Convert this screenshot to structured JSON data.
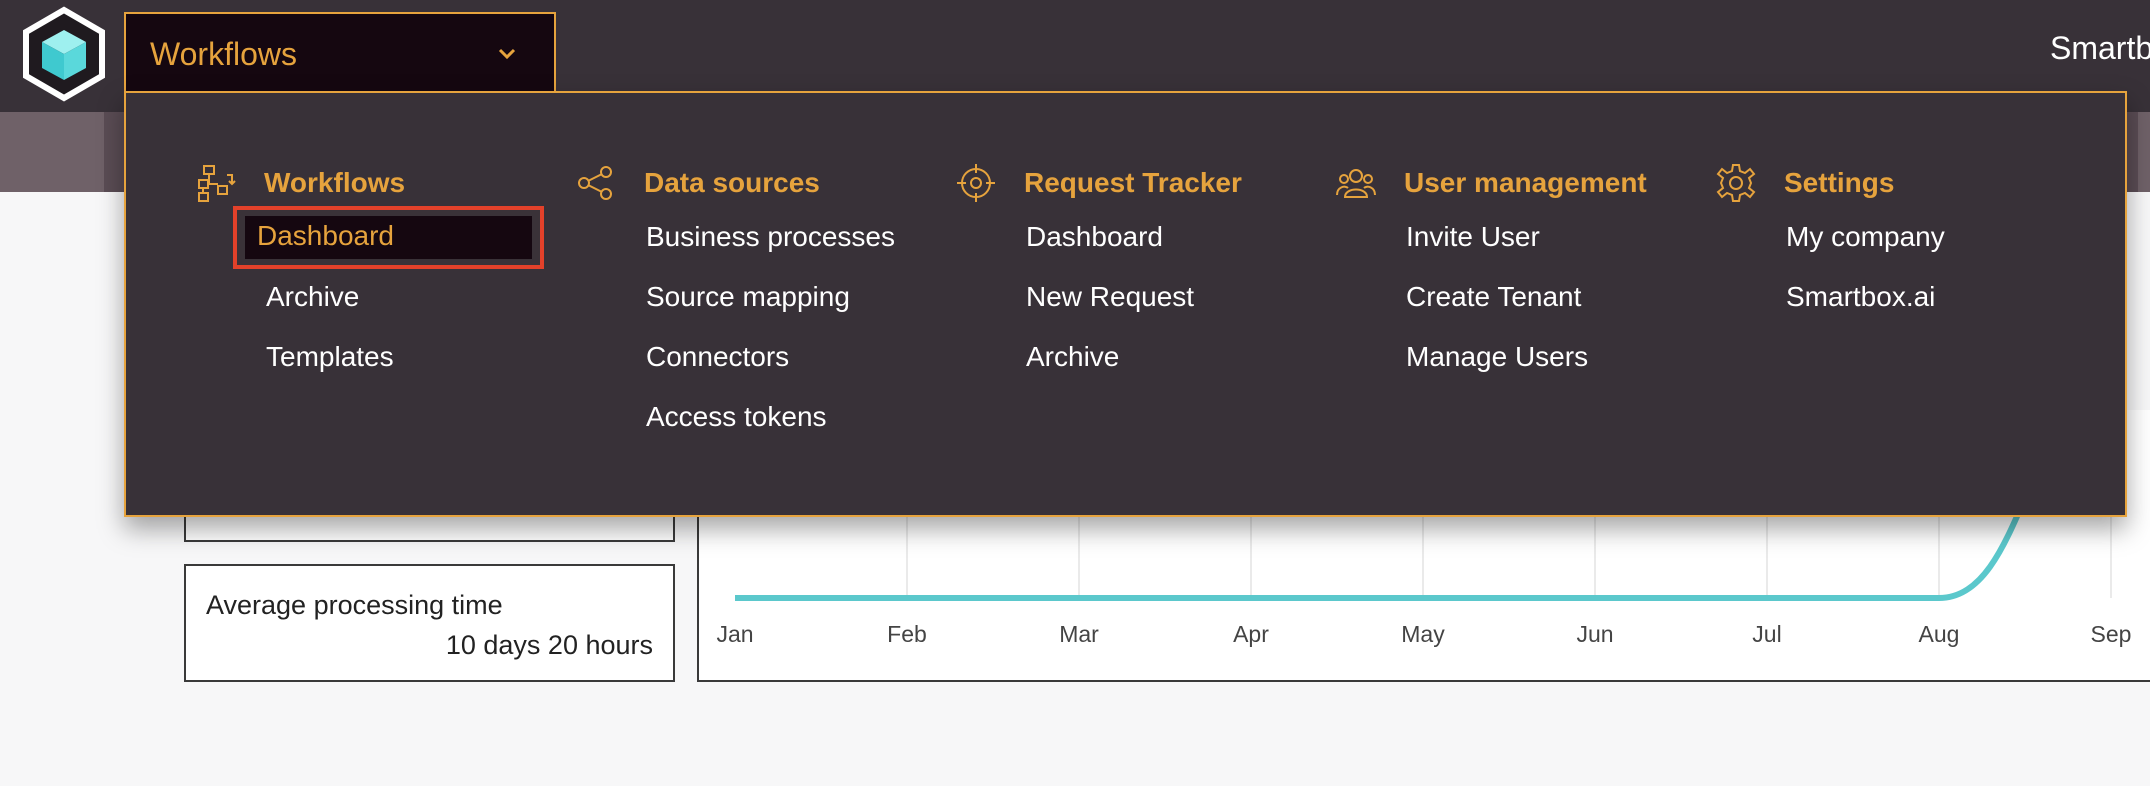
{
  "header": {
    "workflow_select": {
      "label": "Workflows"
    },
    "brand_partial": "Smartb"
  },
  "summary": {
    "avg_processing_label": "Average processing time",
    "avg_processing_value": "10 days 20 hours"
  },
  "chart_data": {
    "type": "line",
    "categories": [
      "Jan",
      "Feb",
      "Mar",
      "Apr",
      "May",
      "Jun",
      "Jul",
      "Aug",
      "Sep"
    ],
    "series": [
      {
        "values": [
          0,
          0,
          0,
          0,
          0,
          0,
          0,
          0,
          1
        ]
      }
    ],
    "color": "#5bc8cc"
  },
  "menu": {
    "columns": [
      {
        "icon": "workflow-tree-icon",
        "title": "Workflows",
        "items": [
          "Dashboard",
          "Archive",
          "Templates"
        ],
        "active_item": "Dashboard"
      },
      {
        "icon": "share-nodes-icon",
        "title": "Data sources",
        "items": [
          "Business processes",
          "Source mapping",
          "Connectors",
          "Access tokens"
        ]
      },
      {
        "icon": "target-icon",
        "title": "Request Tracker",
        "items": [
          "Dashboard",
          "New Request",
          "Archive"
        ]
      },
      {
        "icon": "users-icon",
        "title": "User management",
        "items": [
          "Invite User",
          "Create Tenant",
          "Manage Users"
        ]
      },
      {
        "icon": "gear-icon",
        "title": "Settings",
        "items": [
          "My company",
          "Smartbox.ai"
        ]
      }
    ]
  },
  "colors": {
    "accent": "#e6a33d",
    "highlight": "#e3412a",
    "topbar": "#383138",
    "line": "#5bc8cc"
  }
}
